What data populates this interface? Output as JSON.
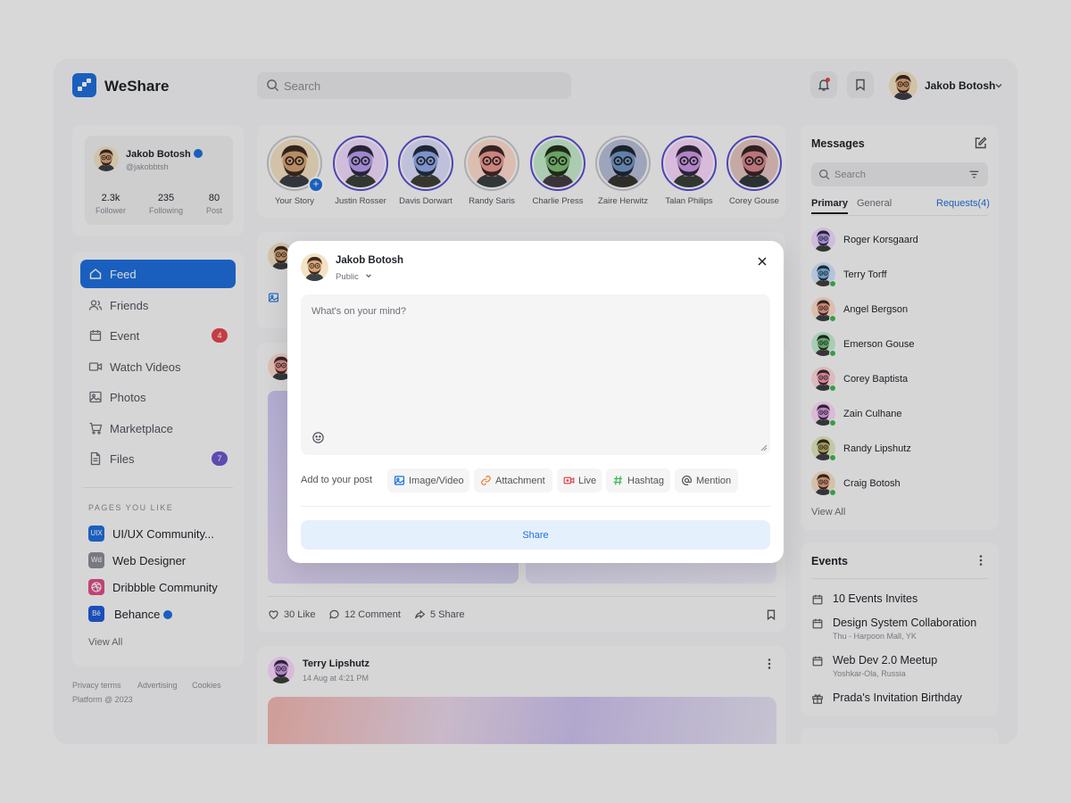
{
  "app": {
    "name": "WeShare"
  },
  "colors": {
    "accent": "#1f6fde",
    "story_ring": "#5b4fd6",
    "online": "#3fb950",
    "badge_red": "#e5484d",
    "badge_purple": "#6e56cf"
  },
  "header": {
    "search_placeholder": "Search",
    "user_name": "Jakob Botosh",
    "icons": [
      "bell-icon",
      "bookmark-icon",
      "chevron-down-icon"
    ]
  },
  "profile": {
    "name": "Jakob Botosh",
    "handle": "@jakobbtsh",
    "stats": [
      {
        "value": "2.3k",
        "label": "Follower"
      },
      {
        "value": "235",
        "label": "Following"
      },
      {
        "value": "80",
        "label": "Post"
      }
    ]
  },
  "nav": {
    "items": [
      {
        "label": "Feed",
        "icon": "home-icon"
      },
      {
        "label": "Friends",
        "icon": "users-icon"
      },
      {
        "label": "Event",
        "icon": "calendar-icon",
        "badge": "4"
      },
      {
        "label": "Watch Videos",
        "icon": "video-icon"
      },
      {
        "label": "Photos",
        "icon": "image-icon"
      },
      {
        "label": "Marketplace",
        "icon": "cart-icon"
      },
      {
        "label": "Files",
        "icon": "file-icon",
        "badge": "7"
      }
    ],
    "pages_title": "PAGES YOU LIKE",
    "pages": [
      {
        "label": "UI/UX Community...",
        "abbr": "UIX",
        "color": "#1f6fde"
      },
      {
        "label": "Web Designer",
        "abbr": "Wd",
        "color": "#8a8d93"
      },
      {
        "label": "Dribbble Community",
        "abbr": "",
        "color": "#e04f8a"
      },
      {
        "label": "Behance",
        "abbr": "Bē",
        "color": "#1f5bd8"
      }
    ],
    "view_all": "View All"
  },
  "footer": {
    "line1": [
      "Privacy terms",
      "Advertising",
      "Cookies"
    ],
    "line2": "Platform @ 2023"
  },
  "stories": [
    {
      "name": "Your Story",
      "seen": true
    },
    {
      "name": "Justin Rosser",
      "seen": false
    },
    {
      "name": "Davis Dorwart",
      "seen": false
    },
    {
      "name": "Randy Saris",
      "seen": true
    },
    {
      "name": "Charlie Press",
      "seen": false
    },
    {
      "name": "Zaire Herwitz",
      "seen": true
    },
    {
      "name": "Talan Philips",
      "seen": false
    },
    {
      "name": "Corey Gouse",
      "seen": false
    }
  ],
  "post": {
    "actions": {
      "like": "30 Like",
      "comment": "12 Comment",
      "share": "5 Share"
    },
    "next_author": "Terry Lipshutz",
    "next_time": "14 Aug at 4:21 PM"
  },
  "messages": {
    "title": "Messages",
    "search_placeholder": "Search",
    "tabs": [
      "Primary",
      "General"
    ],
    "requests": "Requests(4)",
    "contacts": [
      "Roger Korsgaard",
      "Terry Torff",
      "Angel Bergson",
      "Emerson Gouse",
      "Corey Baptista",
      "Zain Culhane",
      "Randy Lipshutz",
      "Craig Botosh"
    ],
    "view_all": "View All"
  },
  "events": {
    "title": "Events",
    "items": [
      {
        "title": "10 Events Invites",
        "sub": ""
      },
      {
        "title": "Design System Collaboration",
        "sub": "Thu - Harpoon Mall, YK"
      },
      {
        "title": "Web Dev 2.0 Meetup",
        "sub": "Yoshkar-Ola, Russia"
      },
      {
        "title": "Prada's Invitation Birthday",
        "sub": ""
      }
    ]
  },
  "modal": {
    "user_name": "Jakob Botosh",
    "privacy": "Public",
    "placeholder": "What's on your mind?",
    "add_label": "Add to your post",
    "chips": [
      {
        "label": "Image/Video",
        "icon": "image-icon",
        "color": "#1f6fde"
      },
      {
        "label": "Attachment",
        "icon": "link-icon",
        "color": "#f07a2b"
      },
      {
        "label": "Live",
        "icon": "live-video-icon",
        "color": "#e5484d"
      },
      {
        "label": "Hashtag",
        "icon": "hashtag-icon",
        "color": "#3fb950"
      },
      {
        "label": "Mention",
        "icon": "at-icon",
        "color": "#50545a"
      }
    ],
    "share_label": "Share"
  }
}
